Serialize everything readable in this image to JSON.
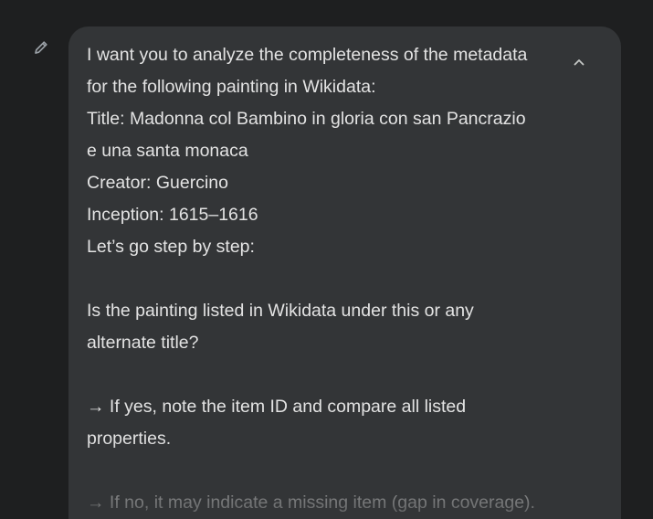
{
  "icons": {
    "edit": "pencil-icon",
    "collapse": "chevron-up-icon"
  },
  "colors": {
    "background": "#1e1f20",
    "bubble": "#333537",
    "text": "#e3e3e3",
    "icon": "#9aa0a6"
  },
  "message": {
    "lines": [
      "I want you to analyze the completeness of the metadata",
      "for the following painting in Wikidata:",
      "Title: Madonna col Bambino in gloria con san Pancrazio",
      "e una santa monaca",
      "Creator: Guercino",
      "Inception: 1615–1616",
      "Let’s go step by step:",
      "",
      "Is the painting listed in Wikidata under this or any",
      "alternate title?",
      "",
      "→ If yes, note the item ID and compare all listed",
      "properties.",
      "",
      "→ If no, it may indicate a missing item (gap in coverage)."
    ]
  }
}
